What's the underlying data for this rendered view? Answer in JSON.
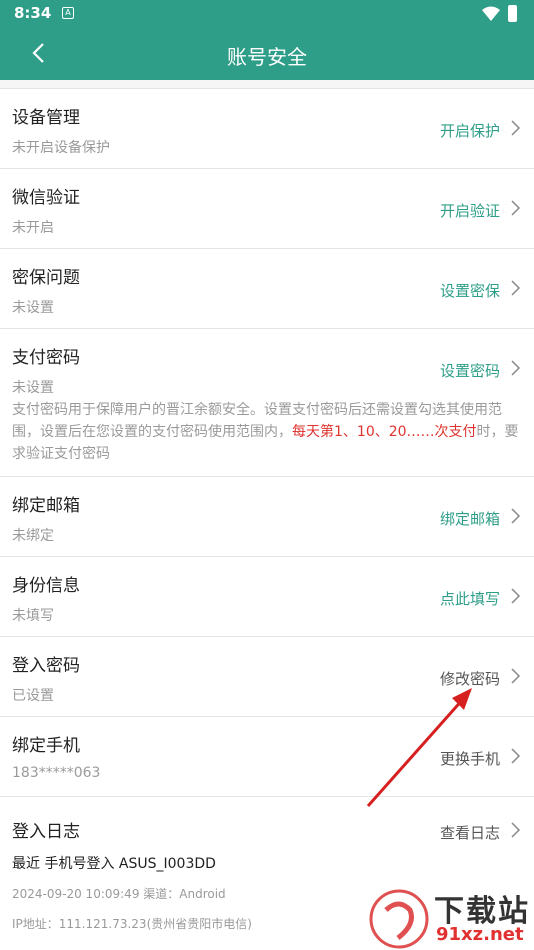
{
  "status_bar": {
    "time": "8:34",
    "app_icon_letter": "A"
  },
  "header": {
    "title": "账号安全"
  },
  "rows": [
    {
      "name": "设备管理",
      "sub": "未开启设备保护",
      "action": "开启保护"
    },
    {
      "name": "微信验证",
      "sub": "未开启",
      "action": "开启验证"
    },
    {
      "name": "密保问题",
      "sub": "未设置",
      "action": "设置密保"
    },
    {
      "name": "支付密码",
      "sub": "未设置",
      "action": "设置密码"
    },
    {
      "name": "绑定邮箱",
      "sub": "未绑定",
      "action": "绑定邮箱"
    },
    {
      "name": "身份信息",
      "sub": "未填写",
      "action": "点此填写"
    },
    {
      "name": "登入密码",
      "sub": "已设置",
      "action": "修改密码"
    },
    {
      "name": "绑定手机",
      "sub": "183*****063",
      "action": "更换手机"
    },
    {
      "name": "登入日志",
      "action": "查看日志"
    }
  ],
  "pay_desc": {
    "part1": "支付密码用于保障用户的晋江余额安全。设置支付密码后还需设置勾选其使用范围，设置后在您设置的支付密码使用范围内，",
    "highlight": "每天第1、10、20……次支付",
    "part2": "时，要求验证支付密码"
  },
  "login_log": {
    "recent": "最近  手机号登入 ASUS_I003DD",
    "time_channel": "2024-09-20 10:09:49    渠道：Android",
    "ip": "IP地址：111.121.73.23(贵州省贵阳市电信)"
  },
  "watermark": {
    "text": "下载站",
    "url": "91xz.net"
  },
  "colors": {
    "brand": "#2e9e89",
    "highlight": "#e0342f",
    "annotation_arrow": "#d62020"
  }
}
